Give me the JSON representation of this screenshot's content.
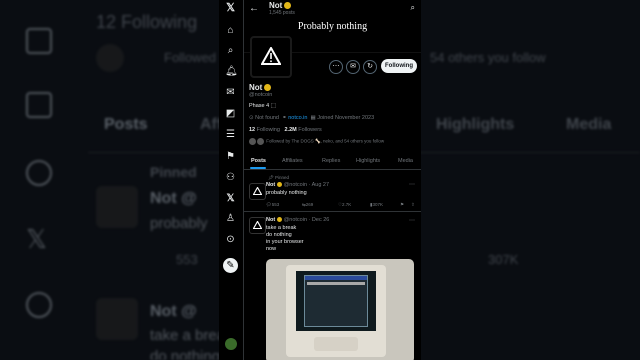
{
  "background": {
    "following_count": "12",
    "following_label": "Following",
    "followed_text": "Followed",
    "followed_tail": "54 others you follow",
    "tabs": [
      "Posts",
      "Affi",
      "Highlights",
      "Media"
    ],
    "pinned": "Pinned",
    "name": "Not",
    "handle_partial": "@",
    "text1": "probably",
    "replies": "553",
    "views": "307K",
    "text2": "take a brea",
    "text3": "do nothing"
  },
  "profile": {
    "top_name": "Not",
    "top_posts": "1,545 posts",
    "banner_text": "Probably nothing",
    "name": "Not",
    "handle": "@notcoin",
    "bio": "Phase 4 ⬚",
    "location": "Not found",
    "website": "notco.in",
    "joined": "Joined November 2023",
    "following_count": "12",
    "following_label": "Following",
    "followers_count": "2.2M",
    "followers_label": "Followers",
    "followed_by": "Followed by The DOGS 🦴, neko, and 54 others you follow",
    "follow_button": "Following"
  },
  "tabs": [
    "Posts",
    "Affiliates",
    "Replies",
    "Highlights",
    "Media"
  ],
  "tweets": [
    {
      "pinned_label": "Pinned",
      "name": "Not",
      "meta": "@notcoin · Aug 27",
      "text": "probably nothing",
      "replies": "553",
      "retweets": "269",
      "likes": "2.7K",
      "views": "307K"
    },
    {
      "name": "Not",
      "meta": "@notcoin · Dec 26",
      "lines": [
        "take a break",
        "do nothing",
        "in your browser",
        "now"
      ]
    }
  ],
  "icons": [
    "x-logo-icon",
    "home-icon",
    "search-icon",
    "notifications-icon",
    "messages-icon",
    "grok-icon",
    "lists-icon",
    "bookmarks-icon",
    "communities-icon",
    "premium-icon",
    "profile-icon",
    "more-icon",
    "post-icon"
  ],
  "colors": {
    "accent": "#1d9bf0",
    "verified": "#e2b719",
    "bg": "#000000"
  }
}
